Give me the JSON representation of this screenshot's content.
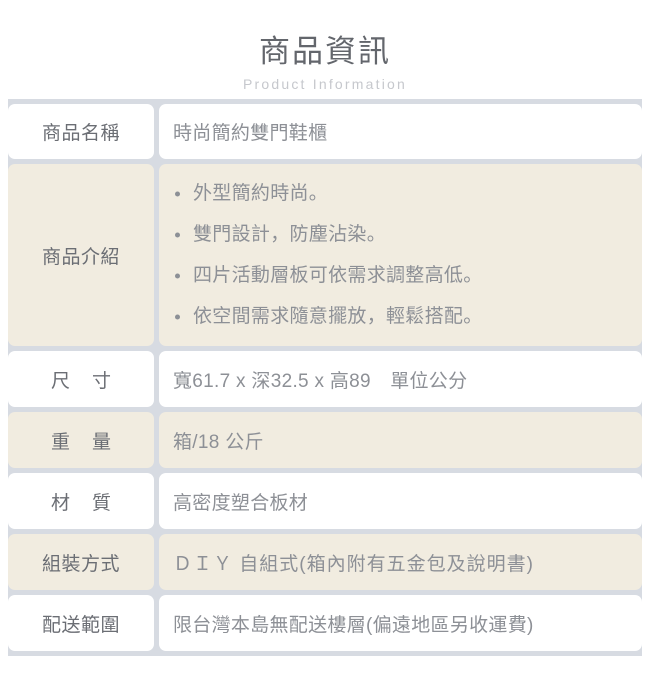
{
  "header": {
    "title": "商品資訊",
    "subtitle": "Product Information"
  },
  "table": {
    "rows": [
      {
        "label": "商品名稱",
        "value": "時尚簡約雙門鞋櫃"
      },
      {
        "label": "商品介紹",
        "bullets": [
          "外型簡約時尚。",
          "雙門設計，防塵沾染。",
          "四片活動層板可依需求調整高低。",
          "依空間需求隨意擺放，輕鬆搭配。"
        ]
      },
      {
        "label": "尺寸",
        "value": "寬61.7 x 深32.5 x 高89　單位公分"
      },
      {
        "label": "重量",
        "value": "箱/18 公斤"
      },
      {
        "label": "材質",
        "value": "高密度塑合板材"
      },
      {
        "label": "組裝方式",
        "value": "ＤＩＹ 自組式(箱內附有五金包及說明書)"
      },
      {
        "label": "配送範圍",
        "value": "限台灣本島無配送樓層(偏遠地區另收運費)"
      }
    ]
  },
  "colors": {
    "page_background": "#ffffff",
    "table_background": "#d7dbe2",
    "cell_light": "#ffffff",
    "cell_dark": "#f1ece0",
    "label_text": "#6b6e74",
    "value_text": "#8d9096",
    "title_text": "#63666c",
    "subtitle_text": "#c6c8cd"
  }
}
